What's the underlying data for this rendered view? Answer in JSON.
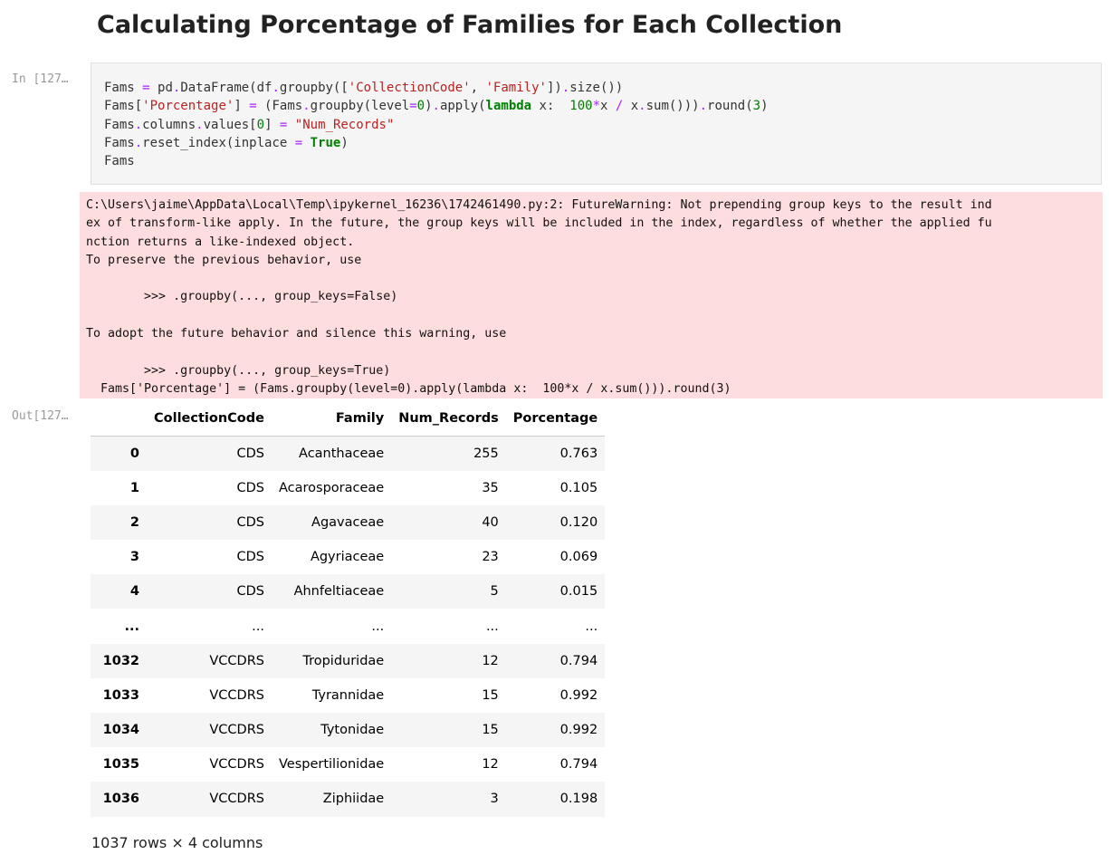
{
  "heading": "Calculating Porcentage of Families for Each Collection",
  "prompts": {
    "in": "In [127…",
    "out": "Out[127…"
  },
  "code": {
    "lines": [
      "Fams = pd.DataFrame(df.groupby(['CollectionCode', 'Family']).size())",
      "Fams['Porcentage'] = (Fams.groupby(level=0).apply(lambda x:  100*x / x.sum())).round(3)",
      "Fams.columns.values[0] = \"Num_Records\"",
      "Fams.reset_index(inplace = True)",
      "Fams"
    ]
  },
  "stderr": {
    "lines": [
      "C:\\Users\\jaime\\AppData\\Local\\Temp\\ipykernel_16236\\1742461490.py:2: FutureWarning: Not prepending group keys to the result ind",
      "ex of transform-like apply. In the future, the group keys will be included in the index, regardless of whether the applied fu",
      "nction returns a like-indexed object.",
      "To preserve the previous behavior, use",
      "",
      "        >>> .groupby(..., group_keys=False)",
      "",
      "To adopt the future behavior and silence this warning, use",
      "",
      "        >>> .groupby(..., group_keys=True)",
      "  Fams['Porcentage'] = (Fams.groupby(level=0).apply(lambda x:  100*x / x.sum())).round(3)"
    ]
  },
  "table": {
    "columns": [
      "",
      "CollectionCode",
      "Family",
      "Num_Records",
      "Porcentage"
    ],
    "rows": [
      [
        "0",
        "CDS",
        "Acanthaceae",
        "255",
        "0.763"
      ],
      [
        "1",
        "CDS",
        "Acarosporaceae",
        "35",
        "0.105"
      ],
      [
        "2",
        "CDS",
        "Agavaceae",
        "40",
        "0.120"
      ],
      [
        "3",
        "CDS",
        "Agyriaceae",
        "23",
        "0.069"
      ],
      [
        "4",
        "CDS",
        "Ahnfeltiaceae",
        "5",
        "0.015"
      ],
      [
        "...",
        "...",
        "...",
        "...",
        "..."
      ],
      [
        "1032",
        "VCCDRS",
        "Tropiduridae",
        "12",
        "0.794"
      ],
      [
        "1033",
        "VCCDRS",
        "Tyrannidae",
        "15",
        "0.992"
      ],
      [
        "1034",
        "VCCDRS",
        "Tytonidae",
        "15",
        "0.992"
      ],
      [
        "1035",
        "VCCDRS",
        "Vespertilionidae",
        "12",
        "0.794"
      ],
      [
        "1036",
        "VCCDRS",
        "Ziphiidae",
        "3",
        "0.198"
      ]
    ]
  },
  "shape_info": "1037 rows × 4 columns",
  "colors": {
    "code_bg": "#f5f5f5",
    "stderr_bg": "#fddddd",
    "keyword": "#008000",
    "string": "#ba2121",
    "operator": "#aa22ff",
    "prompt": "#999999"
  }
}
